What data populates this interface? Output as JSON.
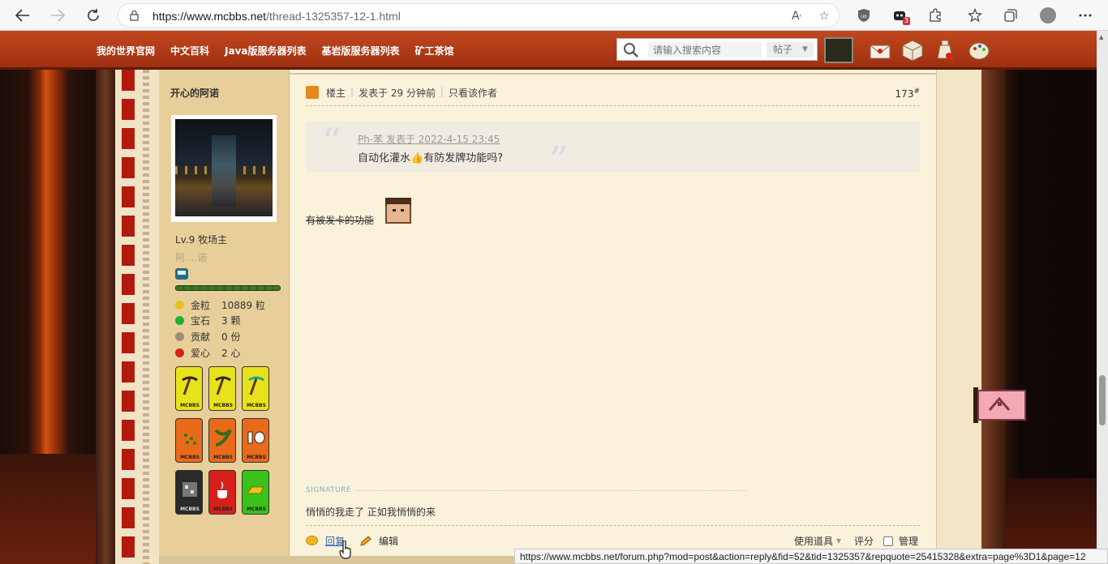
{
  "browser": {
    "url_host": "https://www.mcbbs.net",
    "url_path": "/thread-1325357-12-1.html",
    "extension_badge": "3"
  },
  "site_nav": {
    "links": [
      "我的世界官网",
      "中文百科",
      "Java版服务器列表",
      "基岩版服务器列表",
      "矿工茶馆"
    ],
    "search_placeholder": "请输入搜索内容",
    "search_scope": "帖子"
  },
  "author": {
    "name": "开心的阿诺",
    "level": "Lv.9 牧场主",
    "custom_title": "阿....诺",
    "exp_progress": 1.0,
    "stats": [
      {
        "icon": "gold-nugget-icon",
        "label": "金粒",
        "value": "10889 粒",
        "color": "#e6c21a"
      },
      {
        "icon": "emerald-icon",
        "label": "宝石",
        "value": "3 颗",
        "color": "#1fae3a"
      },
      {
        "icon": "contribution-icon",
        "label": "贡献",
        "value": "0 份",
        "color": "#a08c7a"
      },
      {
        "icon": "heart-apple-icon",
        "label": "爱心",
        "value": "2 心",
        "color": "#d02418"
      }
    ],
    "medal_label": "MCBBS",
    "medals": [
      {
        "name": "iron-pickaxe-medal",
        "bg": "#e8e21a"
      },
      {
        "name": "gold-pickaxe-medal",
        "bg": "#e8e21a"
      },
      {
        "name": "diamond-pickaxe-medal",
        "bg": "#e8e21a"
      },
      {
        "name": "seeds-medal",
        "bg": "#e86a1a"
      },
      {
        "name": "vines-medal",
        "bg": "#e86a1a"
      },
      {
        "name": "ten-anniversary-medal",
        "bg": "#e86a1a"
      },
      {
        "name": "ore-medal",
        "bg": "#2a2a2a"
      },
      {
        "name": "java-medal",
        "bg": "#d8201a"
      },
      {
        "name": "gold-ingot-medal",
        "bg": "#3ac21a"
      }
    ]
  },
  "post": {
    "owner_label": "楼主",
    "posted": "发表于 29 分钟前",
    "only_author": "只看该作者",
    "floor": "173",
    "floor_mark": "#",
    "quote_author": "Ph-苯 发表于 2022-4-15 23:45",
    "quote_text_a": "自动化灌水",
    "quote_emoji": "👍",
    "quote_text_b": "有防发牌功能吗?",
    "body_text": "有被发卡的功能",
    "signature_label": "SIGNATURE",
    "signature_text": "悄悄的我走了 正如我悄悄的来"
  },
  "actions": {
    "reply": "回复",
    "edit": "编辑",
    "use_item": "使用道具",
    "rate": "评分",
    "manage": "管理"
  },
  "status_bar": {
    "link": "https://www.mcbbs.net/forum.php?mod=post&action=reply&fid=52&tid=1325357&repquote=25415328&extra=page%3D1&page=12"
  }
}
